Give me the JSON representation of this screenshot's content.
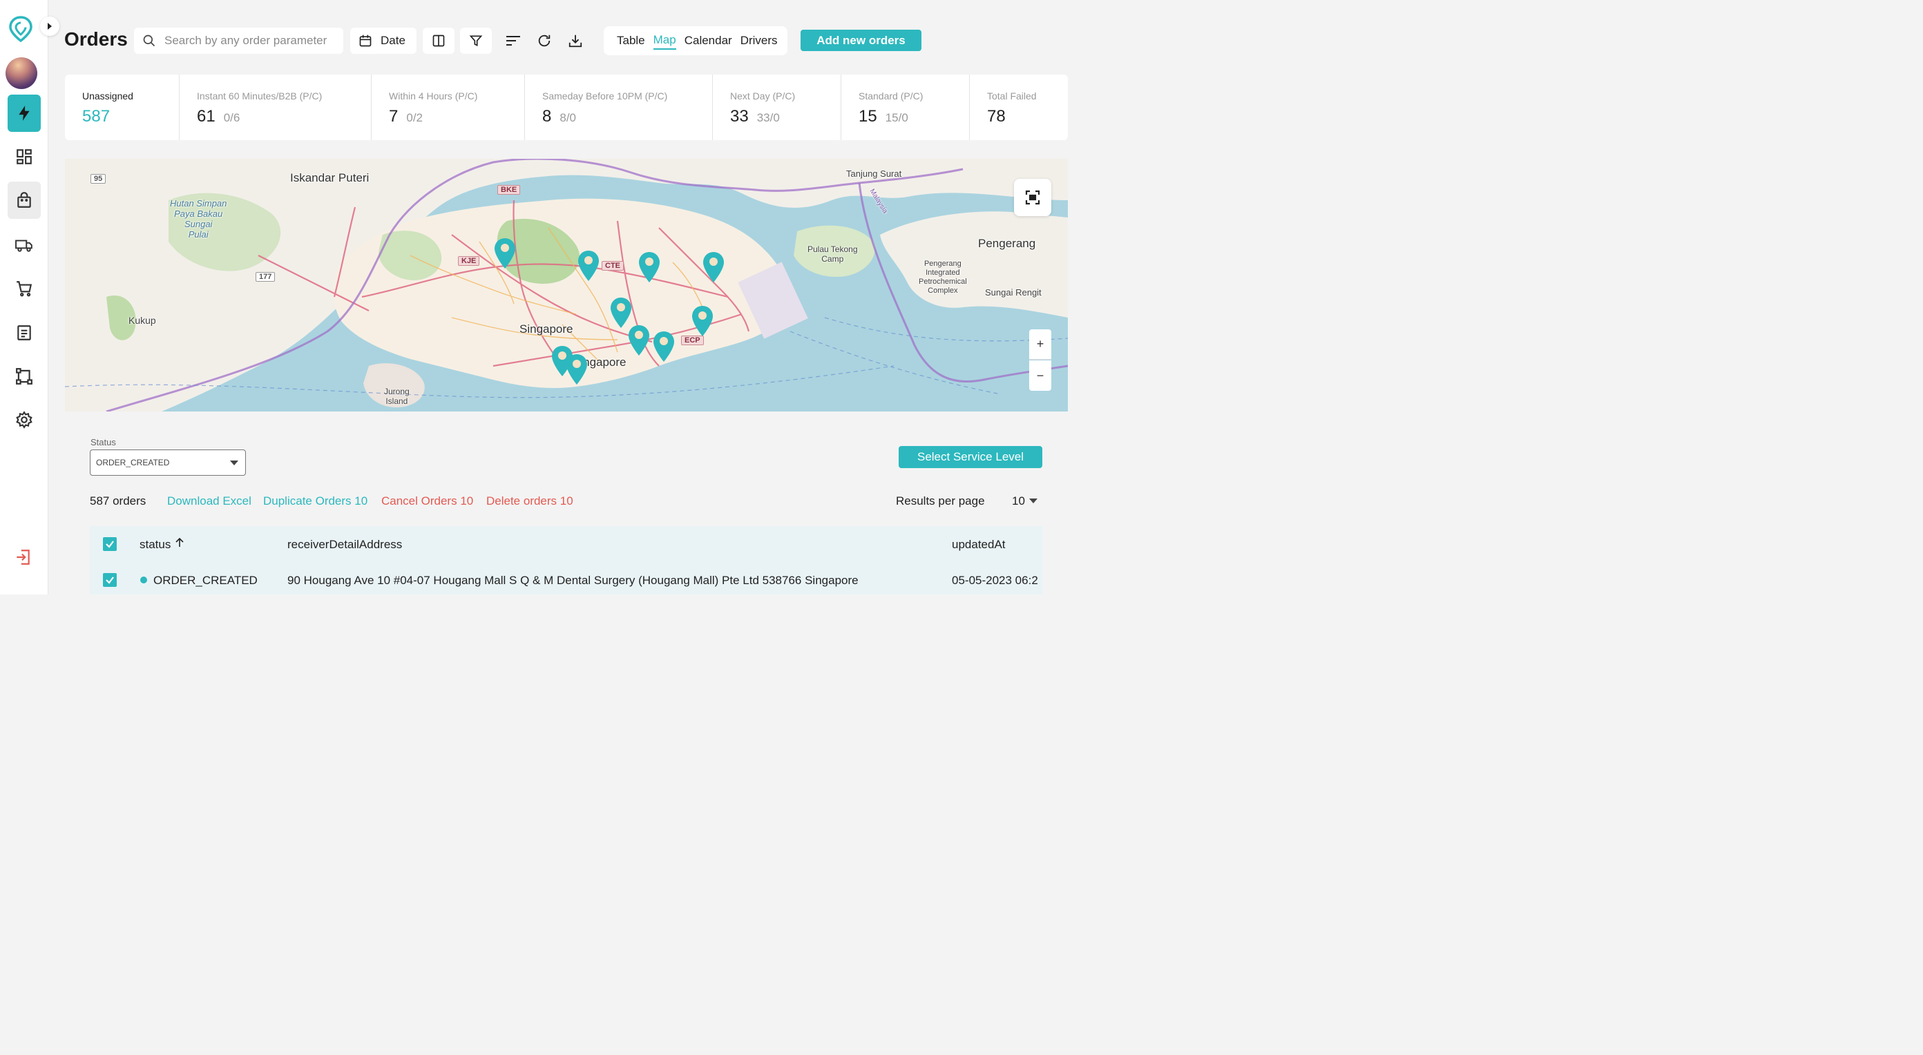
{
  "header": {
    "title": "Orders",
    "search_placeholder": "Search by any order parameter",
    "date_label": "Date",
    "view_tabs": [
      "Table",
      "Map",
      "Calendar",
      "Drivers"
    ],
    "active_view": "Map",
    "add_button": "Add new orders"
  },
  "stats": [
    {
      "label": "Unassigned",
      "value": "587",
      "sub": ""
    },
    {
      "label": "Instant 60 Minutes/B2B (P/C)",
      "value": "61",
      "sub": "0/6"
    },
    {
      "label": "Within 4 Hours (P/C)",
      "value": "7",
      "sub": "0/2"
    },
    {
      "label": "Sameday Before 10PM (P/C)",
      "value": "8",
      "sub": "8/0"
    },
    {
      "label": "Next Day (P/C)",
      "value": "33",
      "sub": "33/0"
    },
    {
      "label": "Standard (P/C)",
      "value": "15",
      "sub": "15/0"
    },
    {
      "label": "Total Failed",
      "value": "78",
      "sub": ""
    }
  ],
  "map": {
    "labels": {
      "iskandar": "Iskandar Puteri",
      "hutan": "Hutan Simpan\nPaya Bakau\nSungai\nPulai",
      "kukup": "Kukup",
      "singapore1": "Singapore",
      "singapore2": "Singapore",
      "jurong": "Jurong\nIsland",
      "tanjung": "Tanjung Surat",
      "tekong": "Pulau Tekong\nCamp",
      "pengerang": "Pengerang",
      "petro": "Pengerang\nIntegrated\nPetrochemical\nComplex",
      "rengit": "Sungai Rengit",
      "malaysia": "Malaysia"
    },
    "shields": {
      "bke": "BKE",
      "kje": "KJE",
      "cte": "CTE",
      "ecp": "ECP",
      "r95": "95",
      "r177": "177"
    },
    "zoom_in": "+",
    "zoom_out": "−"
  },
  "filters": {
    "status_caption": "Status",
    "status_value": "ORDER_CREATED",
    "service_button": "Select Service Level"
  },
  "actions": {
    "count": "587 orders",
    "download": "Download Excel",
    "duplicate": "Duplicate Orders 10",
    "cancel": "Cancel Orders 10",
    "delete": "Delete orders 10",
    "results_label": "Results per page",
    "results_value": "10"
  },
  "table": {
    "columns": [
      "status",
      "receiverDetailAddress",
      "updatedAt"
    ],
    "rows": [
      {
        "status": "ORDER_CREATED",
        "address": "90 Hougang Ave 10 #04-07 Hougang Mall S Q & M Dental Surgery (Hougang Mall) Pte Ltd 538766 Singapore",
        "updated": "05-05-2023 06:2"
      }
    ]
  },
  "colors": {
    "accent": "#2cb8be",
    "danger": "#e25a52"
  }
}
